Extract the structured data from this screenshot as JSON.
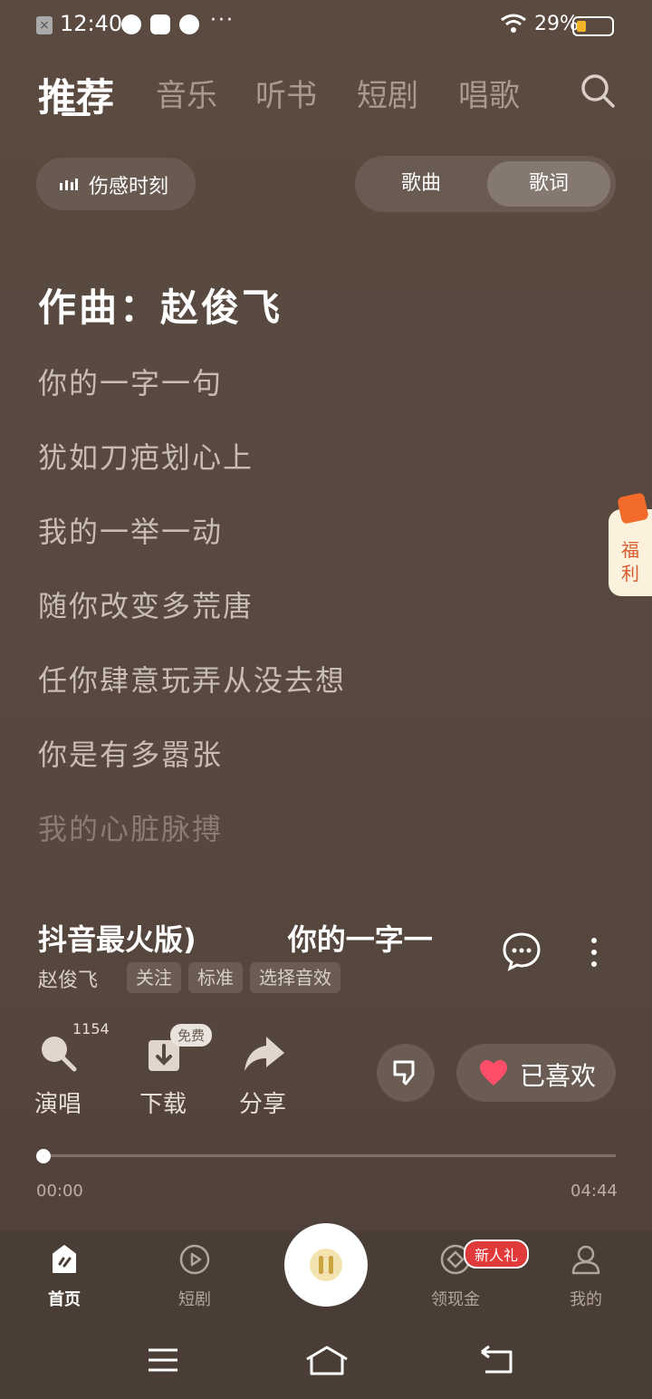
{
  "status_bar": {
    "time": "12:40",
    "battery": "29%",
    "battery_level": 0.29
  },
  "top_nav": {
    "tabs": [
      "推荐",
      "音乐",
      "听书",
      "短剧",
      "唱歌"
    ],
    "active_index": 0
  },
  "mood_chip": {
    "label": "伤感时刻"
  },
  "segmented": {
    "options": [
      "歌曲",
      "歌词"
    ],
    "selected": "歌词"
  },
  "lyrics": {
    "current": "作曲：赵俊飞",
    "lines": [
      "你的一字一句",
      "犹如刀疤划心上",
      "我的一举一动",
      "随你改变多荒唐",
      "任你肆意玩弄从没去想",
      "你是有多嚣张",
      "我的心脏脉搏"
    ]
  },
  "side_badge": {
    "label": "福利"
  },
  "song": {
    "title_part1": "抖音最火版)",
    "title_part2": "你的一字一",
    "artist": "赵俊飞",
    "tags": [
      "关注",
      "标准",
      "选择音效"
    ]
  },
  "actions": {
    "sing_label": "演唱",
    "sing_count": "1154",
    "download_label": "下载",
    "free_badge": "免费",
    "share_label": "分享",
    "liked_label": "已喜欢"
  },
  "progress": {
    "current": "00:00",
    "total": "04:44",
    "fraction": 0.0
  },
  "bottom_nav": {
    "items": [
      "首页",
      "短剧",
      "领现金",
      "我的"
    ],
    "badge": "新人礼",
    "active_index": 0
  },
  "colors": {
    "background": "#574940",
    "accent_heart": "#ff4d6a",
    "badge_red": "#e03a3a",
    "battery": "#f2b52a"
  }
}
